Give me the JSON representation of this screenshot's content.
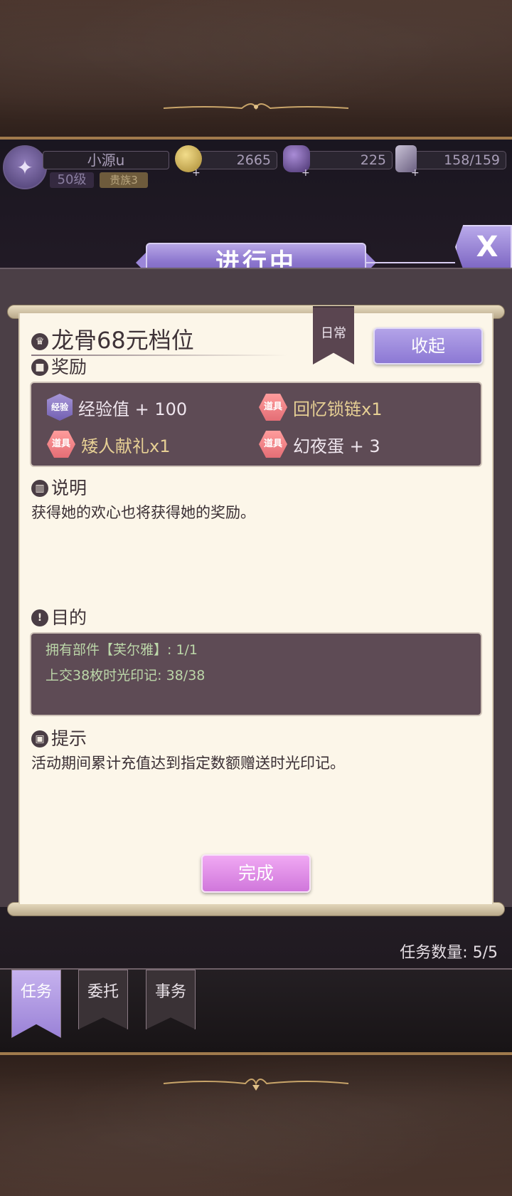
{
  "status": {
    "player_name": "小源u",
    "level": "50级",
    "title": "贵族3",
    "gold": "2665",
    "gems": "225",
    "stamina": "158/159"
  },
  "header": {
    "title": "进行中",
    "close_label": "X"
  },
  "task": {
    "category": "日常",
    "collapse_label": "收起",
    "title": "龙骨68元档位",
    "rewards_label": "奖励",
    "rewards": [
      {
        "badge": "经验",
        "text": "经验值 + 100",
        "type": "exp"
      },
      {
        "badge": "道具",
        "text": "回忆锁链x1",
        "type": "item"
      },
      {
        "badge": "道具",
        "text": "矮人献礼x1",
        "type": "item"
      },
      {
        "badge": "道具",
        "text": "幻夜蛋 + 3",
        "type": "item"
      }
    ],
    "description_label": "说明",
    "description": "获得她的欢心也将获得她的奖励。",
    "objective_label": "目的",
    "objectives": [
      "拥有部件【芙尔雅】: 1/1",
      "上交38枚时光印记: 38/38"
    ],
    "hint_label": "提示",
    "hint": "活动期间累计充值达到指定数额赠送时光印记。",
    "complete_label": "完成"
  },
  "task_count": "任务数量:  5/5",
  "tabs": [
    {
      "label": "任务",
      "active": true
    },
    {
      "label": "委托",
      "active": false
    },
    {
      "label": "事务",
      "active": false
    }
  ],
  "colors": {
    "accent_purple": "#8e78cf",
    "paper": "#fcf6e9",
    "complete_pink": "#d077db"
  }
}
